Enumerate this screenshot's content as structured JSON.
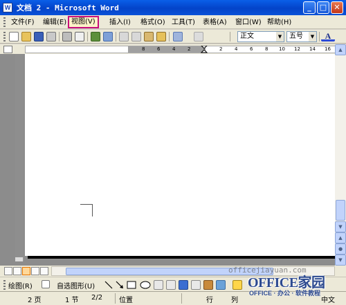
{
  "window": {
    "title": "文档 2 - Microsoft Word",
    "app_icon_letter": "W",
    "minimize_glyph": "_",
    "maximize_glyph": "□",
    "close_glyph": "✕"
  },
  "menubar": {
    "items": [
      {
        "label": "文件(F)"
      },
      {
        "label": "编辑(E)"
      },
      {
        "label": "视图(V)",
        "selected": true
      },
      {
        "label": "插入(I)"
      },
      {
        "label": "格式(O)"
      },
      {
        "label": "工具(T)"
      },
      {
        "label": "表格(A)"
      },
      {
        "label": "窗口(W)"
      },
      {
        "label": "帮助(H)"
      }
    ]
  },
  "toolbar": {
    "style_value": "正文",
    "size_value": "五号",
    "font_color_label": "A"
  },
  "ruler": {
    "numbers": [
      "8",
      "6",
      "4",
      "2",
      "2",
      "4",
      "6",
      "8",
      "10",
      "12",
      "14",
      "16"
    ]
  },
  "drawing_toolbar": {
    "draw_label": "绘图(R)",
    "autoshapes_label": "自选图形(U)"
  },
  "statusbar": {
    "page": "2 页",
    "section": "1 节",
    "page_of": "2/2",
    "position": "位置",
    "line": "行",
    "column": "列",
    "language": "中文"
  },
  "overlay": {
    "url": "officejiayuan.com",
    "logo_main": "OFFICE家园",
    "logo_sub": "OFFICE · 办公 · 软件教程"
  },
  "colors": {
    "titlebar": "#0343c9",
    "highlight_border": "#c8107d",
    "toolbar_bg": "#ece9d8",
    "page_bg": "#ffffff",
    "desk_bg": "#8c8c8c"
  }
}
